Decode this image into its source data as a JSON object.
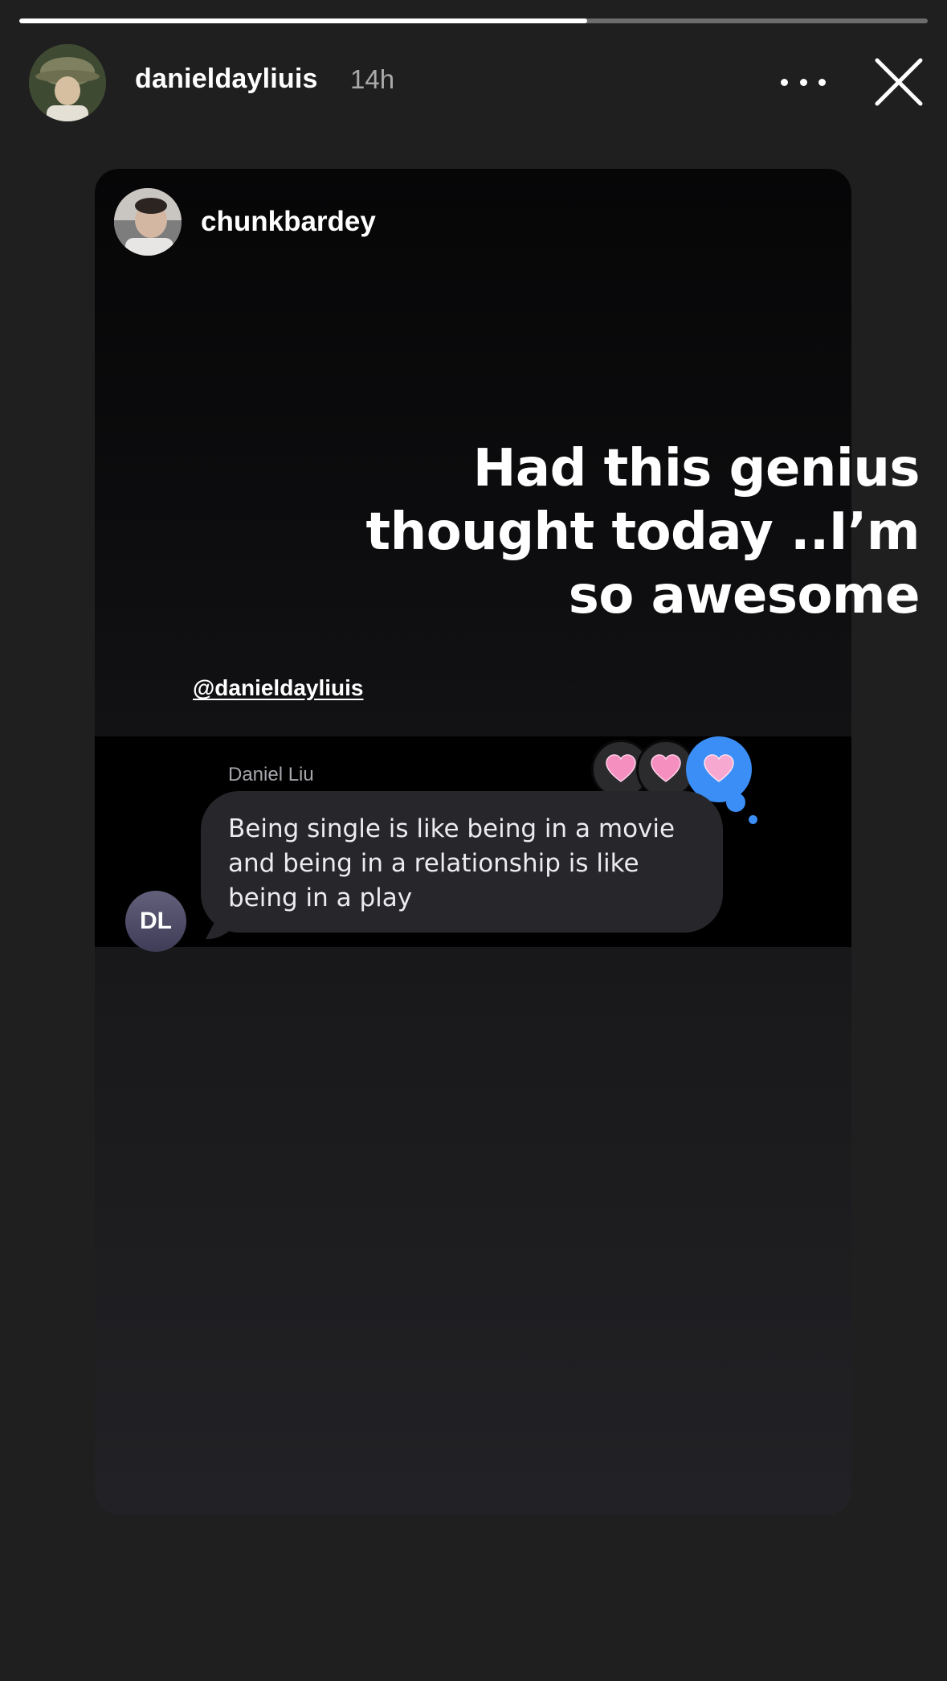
{
  "story": {
    "progress_fraction": 0.625,
    "owner_username": "danieldayliuis",
    "time": "14h",
    "caption": "Had this genius thought today ..I’m so awesome"
  },
  "post": {
    "author_username": "chunkbardey",
    "mention": "@danieldayliuis",
    "chat": {
      "sender_name": "Daniel Liu",
      "sender_initials": "DL",
      "message": "Being single is like being in a movie and being in a relationship is like being in a play",
      "reactions": [
        "heart-emoji",
        "heart-emoji",
        "heart-emoji"
      ]
    }
  },
  "icons": {
    "more": "ellipsis-icon",
    "close": "close-icon"
  },
  "colors": {
    "background": "#1f1f20",
    "reaction_blue": "#3a8ef5",
    "bubble": "#27272b"
  }
}
